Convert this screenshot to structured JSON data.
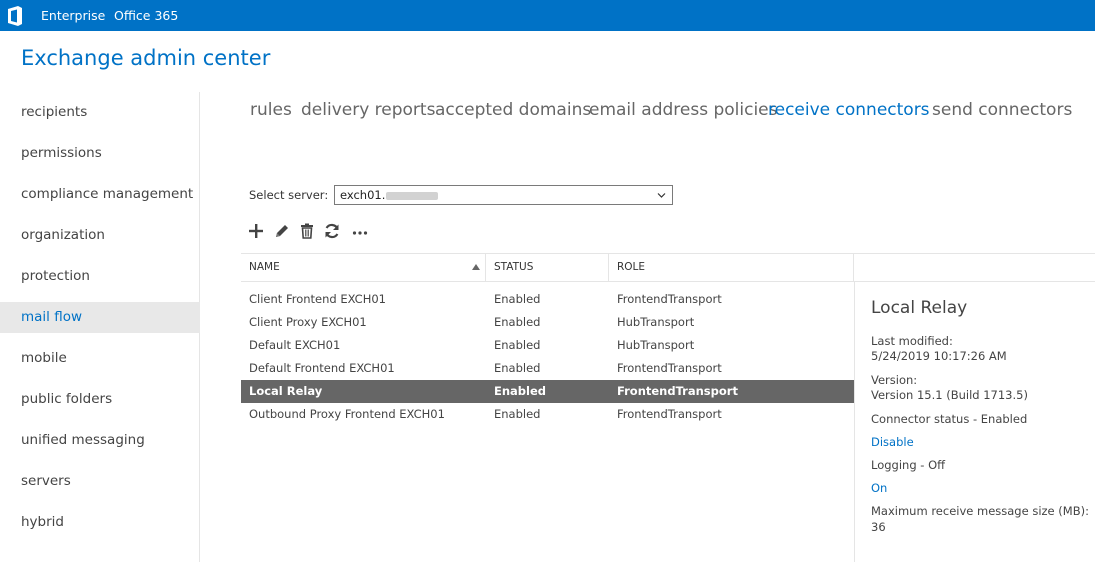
{
  "topbar": {
    "logo_icon": "office-logo-icon",
    "links": [
      "Enterprise",
      "Office 365"
    ]
  },
  "app_title": "Exchange admin center",
  "nav": {
    "items": [
      "recipients",
      "permissions",
      "compliance management",
      "organization",
      "protection",
      "mail flow",
      "mobile",
      "public folders",
      "unified messaging",
      "servers",
      "hybrid"
    ],
    "active": "mail flow"
  },
  "tabs": {
    "items": [
      "rules",
      "delivery reports",
      "accepted domains",
      "email address policies",
      "receive connectors",
      "send connectors"
    ],
    "active": "receive connectors"
  },
  "server_select": {
    "label": "Select server:",
    "value": "exch01."
  },
  "toolbar": {
    "icons": [
      "add-icon",
      "edit-icon",
      "delete-icon",
      "refresh-icon",
      "more-icon"
    ]
  },
  "table": {
    "columns": [
      "NAME",
      "STATUS",
      "ROLE"
    ],
    "sort_indicator": "sort-ascending-icon",
    "rows": [
      {
        "name": "Client Frontend EXCH01",
        "status": "Enabled",
        "role": "FrontendTransport"
      },
      {
        "name": "Client Proxy EXCH01",
        "status": "Enabled",
        "role": "HubTransport"
      },
      {
        "name": "Default EXCH01",
        "status": "Enabled",
        "role": "HubTransport"
      },
      {
        "name": "Default Frontend EXCH01",
        "status": "Enabled",
        "role": "FrontendTransport"
      },
      {
        "name": "Local Relay",
        "status": "Enabled",
        "role": "FrontendTransport"
      },
      {
        "name": "Outbound Proxy Frontend EXCH01",
        "status": "Enabled",
        "role": "FrontendTransport"
      }
    ],
    "selected_row": "Local Relay"
  },
  "details": {
    "title": "Local Relay",
    "last_modified_label": "Last modified:",
    "last_modified_value": "5/24/2019 10:17:26 AM",
    "version_label": "Version:",
    "version_value": "Version 15.1 (Build 1713.5)",
    "connector_status": "Connector status - Enabled",
    "disable_link": "Disable",
    "logging": "Logging - Off",
    "on_link": "On",
    "max_size_label": "Maximum receive message size (MB):",
    "max_size_value": "36"
  },
  "colors": {
    "accent": "#0072c6",
    "selected_row": "#666666"
  }
}
